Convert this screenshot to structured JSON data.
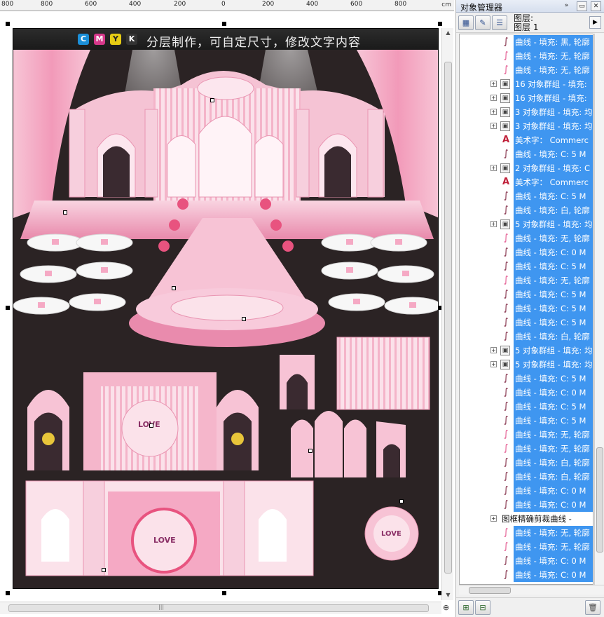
{
  "ruler": {
    "labels": [
      "800",
      "600",
      "400",
      "200",
      "0",
      "200",
      "400",
      "600",
      "800"
    ],
    "corner": "cm"
  },
  "banner": {
    "cmyk": [
      {
        "letter": "C",
        "color": "#1b8fd8"
      },
      {
        "letter": "M",
        "color": "#d6388a"
      },
      {
        "letter": "Y",
        "color": "#e6cc14"
      },
      {
        "letter": "K",
        "color": "#333333"
      }
    ],
    "text": "分层制作，可自定尺寸，修改文字内容"
  },
  "docker": {
    "title": "对象管理器",
    "layer_label_line1": "图层:",
    "layer_label_line2": "图层 1",
    "rows": [
      {
        "type": "curve",
        "label": "曲线 - 填充: 黑, 轮廓",
        "expand": false
      },
      {
        "type": "curve-pink",
        "label": "曲线 - 填充: 无, 轮廓",
        "expand": false
      },
      {
        "type": "curve-pink",
        "label": "曲线 - 填充: 无, 轮廓",
        "expand": false
      },
      {
        "type": "group",
        "label": "16 对象群组 - 填充:",
        "expand": true
      },
      {
        "type": "group",
        "label": "16 对象群组 - 填充:",
        "expand": true
      },
      {
        "type": "group",
        "label": "3 对象群组 - 填充: 均",
        "expand": true
      },
      {
        "type": "group",
        "label": "3 对象群组 - 填充: 均",
        "expand": true
      },
      {
        "type": "text",
        "label": "美术字： Commerc",
        "expand": false
      },
      {
        "type": "curve",
        "label": "曲线 - 填充: C: 5 M",
        "expand": false
      },
      {
        "type": "group",
        "label": "2 对象群组 - 填充: C",
        "expand": true
      },
      {
        "type": "text",
        "label": "美术字： Commerc",
        "expand": false
      },
      {
        "type": "curve",
        "label": "曲线 - 填充: C: 5 M",
        "expand": false
      },
      {
        "type": "curve",
        "label": "曲线 - 填充: 白, 轮廓",
        "expand": false
      },
      {
        "type": "group",
        "label": "5 对象群组 - 填充: 均",
        "expand": true
      },
      {
        "type": "curve-pink",
        "label": "曲线 - 填充: 无, 轮廓",
        "expand": false
      },
      {
        "type": "curve",
        "label": "曲线 - 填充: C: 0 M",
        "expand": false
      },
      {
        "type": "curve",
        "label": "曲线 - 填充: C: 5 M",
        "expand": false
      },
      {
        "type": "curve-pink",
        "label": "曲线 - 填充: 无, 轮廓",
        "expand": false
      },
      {
        "type": "curve",
        "label": "曲线 - 填充: C: 5 M",
        "expand": false
      },
      {
        "type": "curve",
        "label": "曲线 - 填充: C: 5 M",
        "expand": false
      },
      {
        "type": "curve",
        "label": "曲线 - 填充: C: 5 M",
        "expand": false
      },
      {
        "type": "curve",
        "label": "曲线 - 填充: 白, 轮廓",
        "expand": false
      },
      {
        "type": "group",
        "label": "5 对象群组 - 填充: 均",
        "expand": true
      },
      {
        "type": "group",
        "label": "5 对象群组 - 填充: 均",
        "expand": true
      },
      {
        "type": "curve",
        "label": "曲线 - 填充: C: 5 M",
        "expand": false
      },
      {
        "type": "curve",
        "label": "曲线 - 填充: C: 0 M",
        "expand": false
      },
      {
        "type": "curve",
        "label": "曲线 - 填充: C: 5 M",
        "expand": false
      },
      {
        "type": "curve",
        "label": "曲线 - 填充: C: 5 M",
        "expand": false
      },
      {
        "type": "curve-pink",
        "label": "曲线 - 填充: 无, 轮廓",
        "expand": false
      },
      {
        "type": "curve-pink",
        "label": "曲线 - 填充: 无, 轮廓",
        "expand": false
      },
      {
        "type": "curve",
        "label": "曲线 - 填充: 白, 轮廓",
        "expand": false
      },
      {
        "type": "curve",
        "label": "曲线 - 填充: 白, 轮廓",
        "expand": false
      },
      {
        "type": "curve",
        "label": "曲线 - 填充: C: 0 M",
        "expand": false
      },
      {
        "type": "curve",
        "label": "曲线 - 填充: C: 0 M",
        "expand": false
      },
      {
        "type": "plain",
        "label": "图框精确剪裁曲线 -",
        "expand": true
      },
      {
        "type": "curve-pink",
        "label": "曲线 - 填充: 无, 轮廓",
        "expand": false
      },
      {
        "type": "curve-pink",
        "label": "曲线 - 填充: 无, 轮廓",
        "expand": false
      },
      {
        "type": "curve",
        "label": "曲线 - 填充: C: 0 M",
        "expand": false
      },
      {
        "type": "curve",
        "label": "曲线 - 填充: C: 0 M",
        "expand": false
      }
    ]
  },
  "colors": {
    "selection": "#3f96f0",
    "stage_pink": "#f2b8cf",
    "stage_dark": "#2b2324"
  }
}
